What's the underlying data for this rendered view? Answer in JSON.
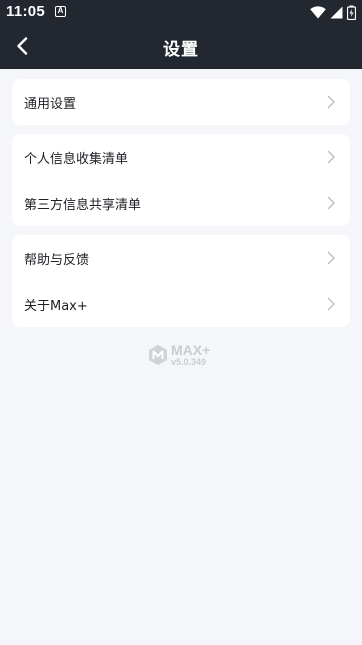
{
  "status_bar": {
    "time": "11:05",
    "app_icon_letter": "A"
  },
  "header": {
    "title": "设置"
  },
  "sections": [
    {
      "items": [
        {
          "label": "通用设置"
        }
      ]
    },
    {
      "items": [
        {
          "label": "个人信息收集清单"
        },
        {
          "label": "第三方信息共享清单"
        }
      ]
    },
    {
      "items": [
        {
          "label": "帮助与反馈"
        },
        {
          "label": "关于Max+"
        }
      ]
    }
  ],
  "footer": {
    "brand": "MAX+",
    "version": "v5.0.349"
  },
  "colors": {
    "header_bg": "#232730",
    "page_bg": "#f5f6f9",
    "card_bg": "#ffffff",
    "logo": "#c8ccd3"
  }
}
